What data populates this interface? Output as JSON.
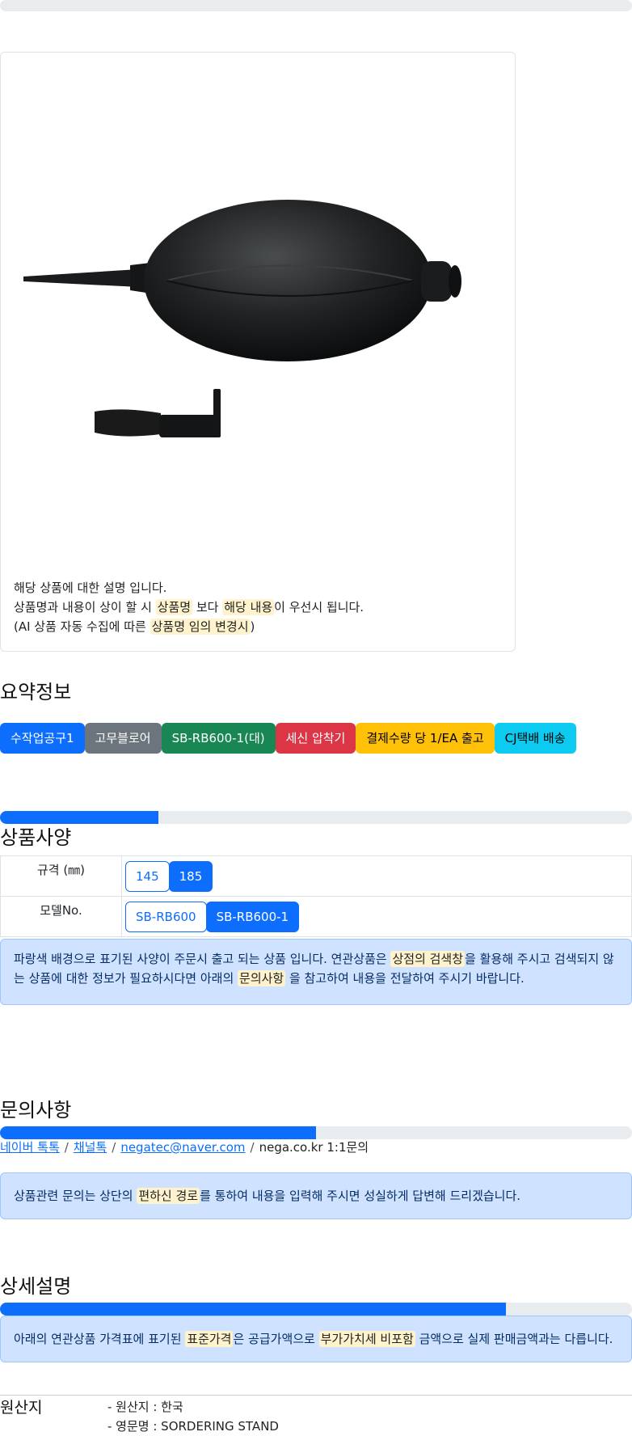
{
  "product": {
    "description_lines": [
      {
        "parts": [
          {
            "t": "해당 상품에 대한 설명 입니다."
          }
        ]
      },
      {
        "parts": [
          {
            "t": "상품명과 내용이 상이 할 시 "
          },
          {
            "t": "상품명",
            "m": true
          },
          {
            "t": " 보다 "
          },
          {
            "t": "해당 내용",
            "m": true
          },
          {
            "t": "이 우선시 됩니다."
          }
        ]
      },
      {
        "parts": [
          {
            "t": "(AI 상품 자동 수집에 따른 "
          },
          {
            "t": "상품명 임의 변경시",
            "m": true
          },
          {
            "t": ")"
          }
        ]
      }
    ],
    "image_alt": "blower-with-brush-image"
  },
  "summary": {
    "title": "요약정보",
    "badges": [
      {
        "label": "수작업공구1",
        "bg": "#0d6efd",
        "fg": "#ffffff"
      },
      {
        "label": "고무블로어",
        "bg": "#6c757d",
        "fg": "#ffffff"
      },
      {
        "label": "SB-RB600-1(대)",
        "bg": "#198754",
        "fg": "#ffffff"
      },
      {
        "label": "세신 압착기",
        "bg": "#dc3545",
        "fg": "#ffffff"
      },
      {
        "label": "결제수량 당 1/EA 출고",
        "bg": "#ffc107",
        "fg": "#000000"
      },
      {
        "label": "CJ택배 배송",
        "bg": "#0dcaf0",
        "fg": "#000000"
      }
    ],
    "progress": 0.25
  },
  "specs": {
    "title": "상품사양",
    "rows": [
      {
        "label": "규격 (㎜)",
        "options": [
          {
            "v": "145",
            "active": false
          },
          {
            "v": "185",
            "active": true
          }
        ]
      },
      {
        "label": "모델No.",
        "options": [
          {
            "v": "SB-RB600",
            "active": false
          },
          {
            "v": "SB-RB600-1",
            "active": true
          }
        ]
      }
    ],
    "notice_lines": [
      {
        "parts": [
          {
            "t": "파랑색 배경으로 표기된 사양이 주문시 출고 되는 상품 입니다. 연관상품은 "
          },
          {
            "t": "상점의 검색창",
            "m": true
          },
          {
            "t": "을 활용해 주시고 검색되지 않"
          }
        ]
      },
      {
        "parts": [
          {
            "t": "는 상품에 대한 정보가 필요하시다면 아래의 "
          },
          {
            "t": "문의사항",
            "m": true
          },
          {
            "t": " 을 참고하여 내용을 전달하여 주시기 바랍니다."
          }
        ]
      }
    ]
  },
  "inquiry": {
    "title": "문의사항",
    "progress": 0.5,
    "links": [
      "네이버 톡톡",
      "채널톡",
      "negatec@naver.com"
    ],
    "plain": "nega.co.kr 1:1문의",
    "separator": "/",
    "notice_lines": [
      {
        "parts": [
          {
            "t": "상품관련 문의는 상단의 "
          },
          {
            "t": "편하신 경로",
            "m": true
          },
          {
            "t": "를 통하여 내용을 입력해 주시면 성실하게 답변해 드리겠습니다."
          }
        ]
      }
    ]
  },
  "detail": {
    "title": "상세설명",
    "progress": 0.8,
    "notice_lines": [
      {
        "parts": [
          {
            "t": "아래의 연관상품 가격표에 표기된 "
          },
          {
            "t": "표준가격",
            "m": true
          },
          {
            "t": "은 공급가액으로 "
          },
          {
            "t": "부가가치세 비포함",
            "m": true
          },
          {
            "t": " 금액으로 실제 판매금액과는 다릅니다."
          }
        ]
      }
    ]
  },
  "origin": {
    "label": "원산지",
    "lines": [
      "- 원산지 : 한국",
      "- 영문명 : SORDERING STAND"
    ]
  },
  "top_progress": 0.0
}
